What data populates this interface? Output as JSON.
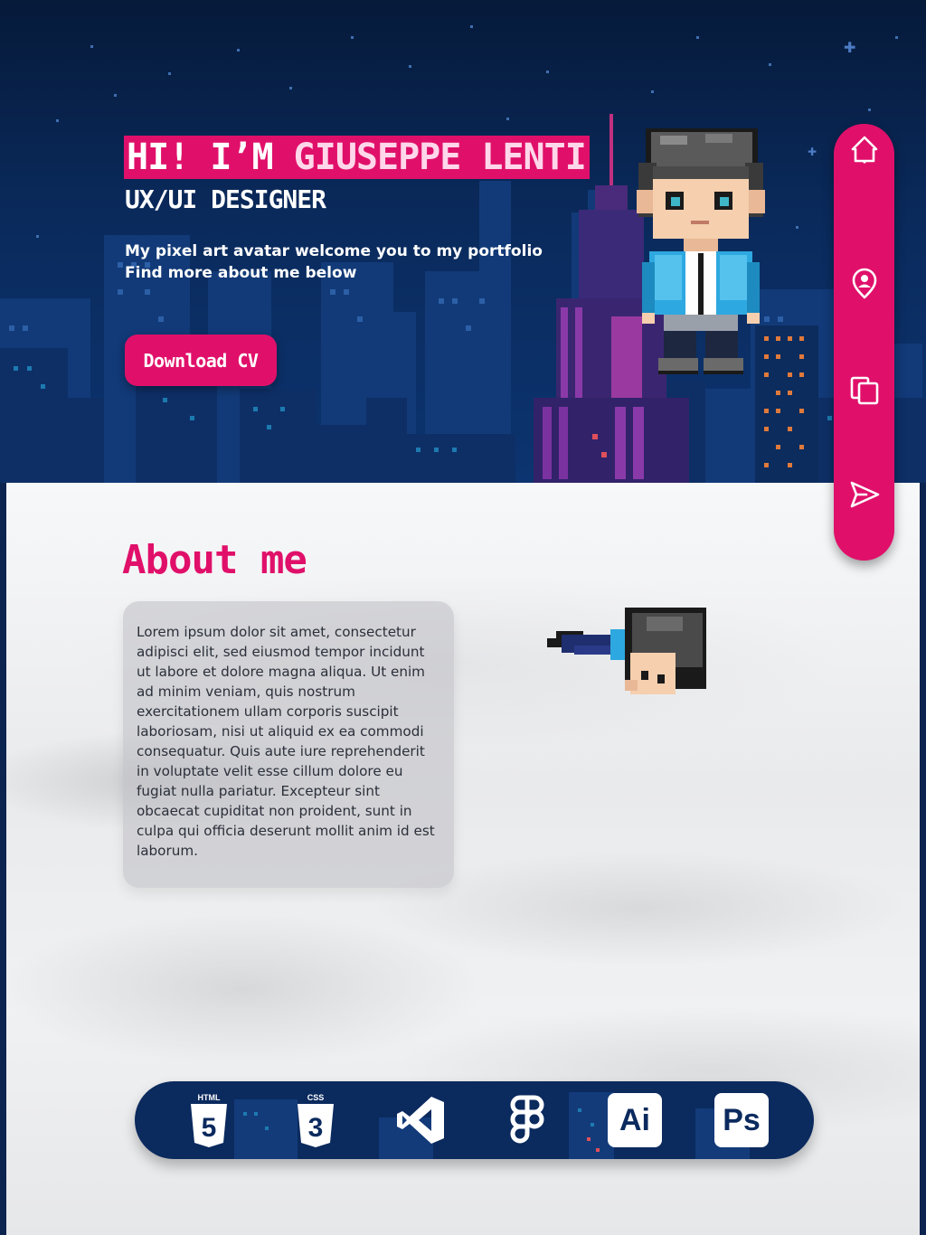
{
  "colors": {
    "accent": "#e0106a",
    "navy": "#0b2a5e",
    "sky": "#0a2a5c"
  },
  "hero": {
    "greeting": "HI! I’M ",
    "name": "GIUSEPPE LENTI",
    "role": "UX/UI DESIGNER",
    "line1": "My pixel art avatar welcome you to my portfolio",
    "line2": "Find more about me below",
    "cv_label": "Download CV"
  },
  "about": {
    "title": "About me",
    "text": "Lorem ipsum dolor sit amet, consectetur adipisci elit, sed eiusmod tempor incidunt ut labore et dolore magna aliqua. Ut enim ad minim veniam, quis nostrum exercitationem ullam corporis suscipit laboriosam, nisi ut aliquid ex ea commodi consequatur. Quis aute iure reprehenderit in voluptate velit esse cillum dolore eu fugiat nulla pariatur. Excepteur sint obcaecat cupiditat non proident, sunt in culpa qui officia deserunt mollit anim id est laborum."
  },
  "nav": [
    {
      "icon": "home-icon"
    },
    {
      "icon": "user-pin-icon"
    },
    {
      "icon": "documents-icon"
    },
    {
      "icon": "send-icon"
    }
  ],
  "tools": {
    "html_label": "HTML",
    "html_num": "5",
    "css_label": "CSS",
    "css_num": "3",
    "vscode_icon": "vscode-icon",
    "figma_icon": "figma-icon",
    "ai_label": "Ai",
    "ps_label": "Ps"
  }
}
